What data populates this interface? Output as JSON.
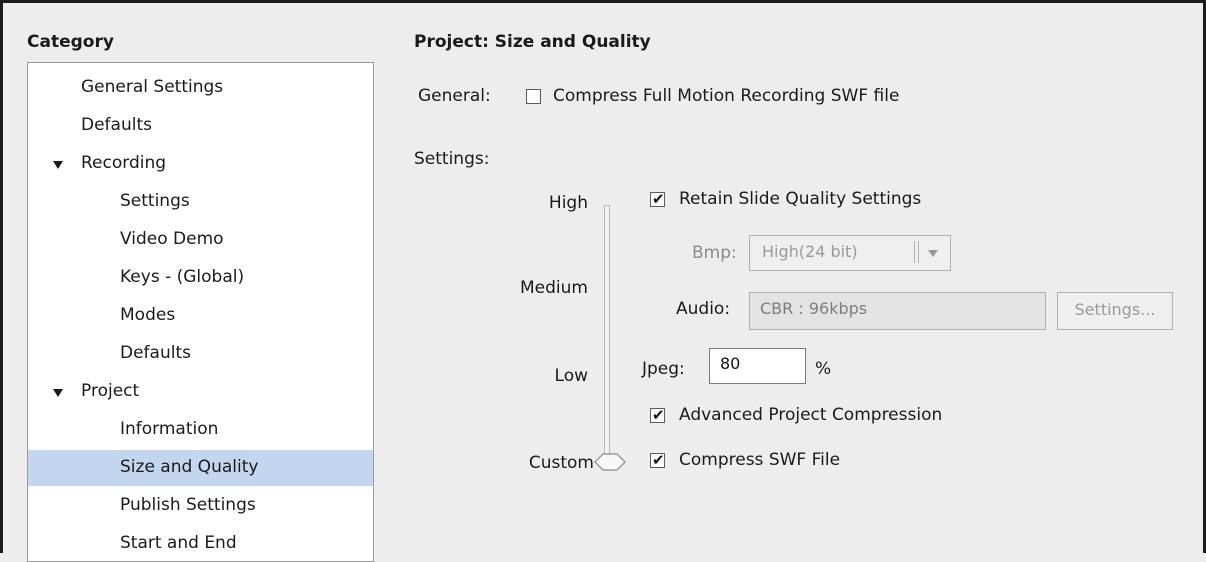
{
  "category": {
    "heading": "Category",
    "items": [
      {
        "label": "General Settings",
        "level": 0,
        "expanded": null,
        "selected": false
      },
      {
        "label": "Defaults",
        "level": 0,
        "expanded": null,
        "selected": false
      },
      {
        "label": "Recording",
        "level": 0,
        "expanded": true,
        "selected": false
      },
      {
        "label": "Settings",
        "level": 1,
        "expanded": null,
        "selected": false
      },
      {
        "label": "Video Demo",
        "level": 1,
        "expanded": null,
        "selected": false
      },
      {
        "label": "Keys - (Global)",
        "level": 1,
        "expanded": null,
        "selected": false
      },
      {
        "label": "Modes",
        "level": 1,
        "expanded": null,
        "selected": false
      },
      {
        "label": "Defaults",
        "level": 1,
        "expanded": null,
        "selected": false
      },
      {
        "label": "Project",
        "level": 0,
        "expanded": true,
        "selected": false
      },
      {
        "label": "Information",
        "level": 1,
        "expanded": null,
        "selected": false
      },
      {
        "label": "Size and Quality",
        "level": 1,
        "expanded": null,
        "selected": true
      },
      {
        "label": "Publish Settings",
        "level": 1,
        "expanded": null,
        "selected": false
      },
      {
        "label": "Start and End",
        "level": 1,
        "expanded": null,
        "selected": false
      }
    ]
  },
  "panel": {
    "title": "Project: Size and Quality",
    "general_label": "General:",
    "compress_full_motion": {
      "label": "Compress Full Motion Recording SWF file",
      "checked": false
    },
    "settings_label": "Settings:",
    "quality_levels": [
      "High",
      "Medium",
      "Low",
      "Custom"
    ],
    "selected_quality": "Custom",
    "retain_slide_quality": {
      "label": "Retain Slide Quality Settings",
      "checked": true
    },
    "bmp": {
      "label": "Bmp:",
      "value": "High(24 bit)",
      "enabled": false
    },
    "audio": {
      "label": "Audio:",
      "value": "CBR : 96kbps",
      "settings_button": "Settings...",
      "enabled": false
    },
    "jpeg": {
      "label": "Jpeg:",
      "value": "80",
      "unit": "%"
    },
    "advanced_compression": {
      "label": "Advanced Project Compression",
      "checked": true
    },
    "compress_swf": {
      "label": "Compress SWF File",
      "checked": true
    }
  },
  "colors": {
    "selection": "#c3d5ef",
    "background": "#ededed",
    "frame": "#1c1c1c"
  }
}
